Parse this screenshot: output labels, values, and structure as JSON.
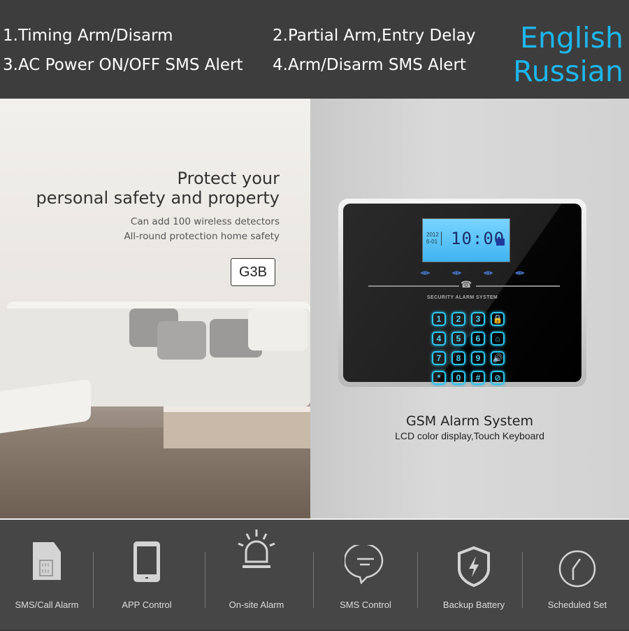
{
  "header": {
    "features": [
      "1.Timing Arm/Disarm",
      "2.Partial Arm,Entry Delay",
      "3.AC Power ON/OFF SMS Alert",
      "4.Arm/Disarm SMS Alert"
    ],
    "languages": [
      "English",
      "Russian"
    ],
    "accent_color": "#1eb6ec"
  },
  "promo": {
    "headline_1": "Protect your",
    "headline_2": "personal safety and property",
    "sub_1": "Can add 100 wireless detectors",
    "sub_2": "All-round protection home safety",
    "model": "G3B"
  },
  "device": {
    "lcd_date_1": "2012",
    "lcd_date_2": "6-01",
    "lcd_time": "10:00",
    "brand": "SECURITY ALARM SYSTEM",
    "keys": [
      "1",
      "2",
      "3",
      "🔒",
      "4",
      "5",
      "6",
      "⌂",
      "7",
      "8",
      "9",
      "🔊",
      "*",
      "0",
      "#",
      "⊘"
    ]
  },
  "product": {
    "title": "GSM Alarm System",
    "subtitle": "LCD color display,Touch Keyboard"
  },
  "features": [
    {
      "label": "SMS/Call Alarm",
      "icon": "sim-card-icon"
    },
    {
      "label": "APP Control",
      "icon": "smartphone-icon"
    },
    {
      "label": "On-site Alarm",
      "icon": "siren-icon"
    },
    {
      "label": "SMS Control",
      "icon": "chat-bubble-icon"
    },
    {
      "label": "Backup Battery",
      "icon": "shield-bolt-icon"
    },
    {
      "label": "Scheduled Set",
      "icon": "clock-icon"
    }
  ]
}
